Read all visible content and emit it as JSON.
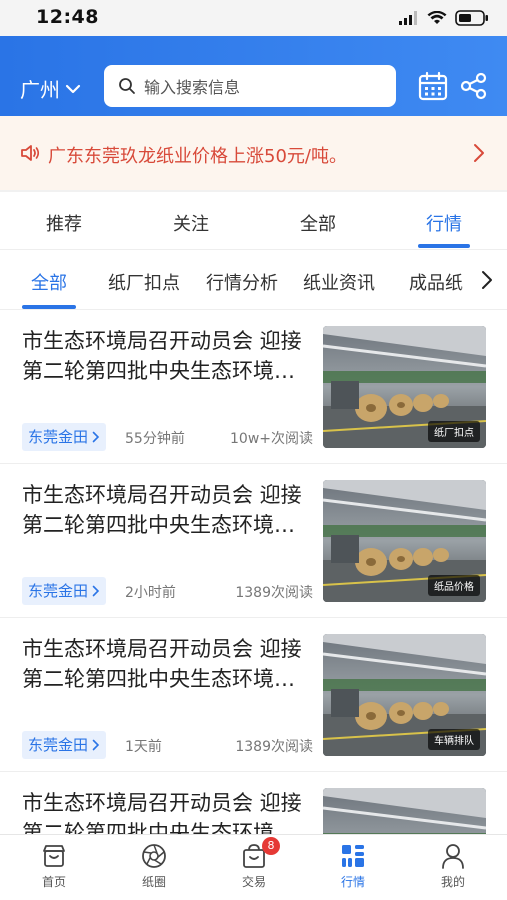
{
  "status": {
    "time": "12:48"
  },
  "header": {
    "city": "广州",
    "search_placeholder": "输入搜索信息"
  },
  "notice": {
    "text": "广东东莞玖龙纸业价格上涨50元/吨。"
  },
  "tabs": [
    {
      "label": "推荐"
    },
    {
      "label": "关注"
    },
    {
      "label": "全部"
    },
    {
      "label": "行情"
    }
  ],
  "subtabs": [
    {
      "label": "全部"
    },
    {
      "label": "纸厂扣点"
    },
    {
      "label": "行情分析"
    },
    {
      "label": "纸业资讯"
    },
    {
      "label": "成品纸"
    }
  ],
  "news": [
    {
      "title": "市生态环境局召开动员会 迎接第二轮第四批中央生态环境…",
      "tag": "东莞金田",
      "time": "55分钟前",
      "reads": "10w+次阅读",
      "img_label": "纸厂扣点"
    },
    {
      "title": "市生态环境局召开动员会 迎接第二轮第四批中央生态环境…",
      "tag": "东莞金田",
      "time": "2小时前",
      "reads": "1389次阅读",
      "img_label": "纸品价格"
    },
    {
      "title": "市生态环境局召开动员会 迎接第二轮第四批中央生态环境…",
      "tag": "东莞金田",
      "time": "1天前",
      "reads": "1389次阅读",
      "img_label": "车辆排队"
    },
    {
      "title": "市生态环境局召开动员会 迎接第二轮第四批中央生态环境…",
      "tag": "",
      "time": "",
      "reads": "",
      "img_label": ""
    }
  ],
  "bottom_nav": [
    {
      "label": "首页",
      "icon": "home-icon"
    },
    {
      "label": "纸圈",
      "icon": "aperture-icon"
    },
    {
      "label": "交易",
      "icon": "bag-icon",
      "badge": "8"
    },
    {
      "label": "行情",
      "icon": "grid-icon"
    },
    {
      "label": "我的",
      "icon": "person-icon"
    }
  ],
  "colors": {
    "accent": "#2a74e6",
    "notice_text": "#d84a3a",
    "badge": "#e53935"
  }
}
